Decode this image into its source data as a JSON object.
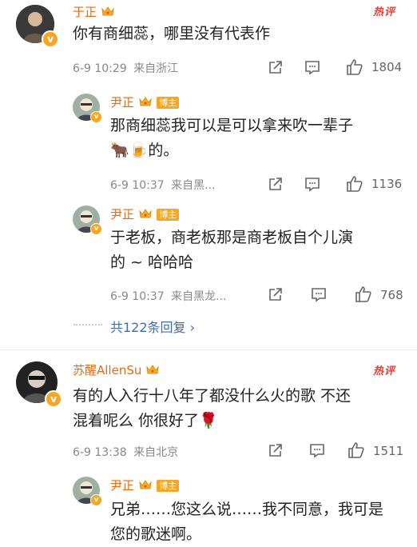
{
  "hot_label": "热评",
  "comments": [
    {
      "user": "于正",
      "text": "你有商细蕊，哪里没有代表作",
      "time": "6-9 10:29",
      "location": "来自浙江",
      "likes": "1804"
    },
    {
      "user": "苏醒AllenSu",
      "text_line1": "有的人入行十八年了都没什么火的歌 不还",
      "text_line2": "混着呢么 你很好了🌹",
      "time": "6-9 13:38",
      "location": "来自北京",
      "likes": "1511"
    }
  ],
  "replies": [
    {
      "user": "尹正",
      "badge": "博主",
      "text_line1": "那商细蕊我可以是可以拿来吹一辈子",
      "text_line2": "🐂🍺的。",
      "time": "6-9 10:37",
      "location": "来自黑...",
      "likes": "1136"
    },
    {
      "user": "尹正",
      "badge": "博主",
      "text_line1": "于老板，商老板那是商老板自个儿演",
      "text_line2": "的 ~ 哈哈哈",
      "time": "6-9 10:37",
      "location": "来自黑龙...",
      "likes": "768"
    },
    {
      "user": "尹正",
      "badge": "博主",
      "text_line1": "兄弟……您这么说……我不同意，我可是",
      "text_line2": "您的歌迷啊。"
    }
  ],
  "more_replies": "共122条回复 ›"
}
